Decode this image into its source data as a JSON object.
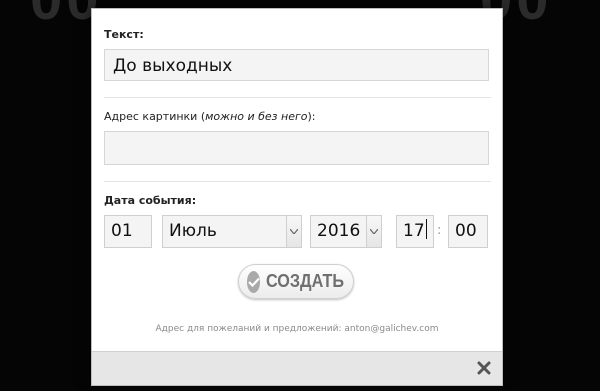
{
  "form": {
    "text_label": "Текст:",
    "text_value": "До выходных",
    "image_label_prefix": "Адрес картинки (",
    "image_label_italic": "можно и без него",
    "image_label_suffix": "):",
    "image_value": "",
    "date_label": "Дата события:",
    "day": "01",
    "month": "Июль",
    "year": "2016",
    "hour": "17",
    "minute": "00",
    "time_separator": ":",
    "create_label": "СОЗДАТЬ",
    "footer": "Адрес для пожеланий и предложений: anton@galichev.com"
  },
  "icons": {
    "create": "check-icon",
    "close": "close-icon",
    "dropdown": "chevron-down-icon"
  },
  "colors": {
    "backdrop": "#050505",
    "button_text": "#6f6f6f",
    "footer_bar": "#e6e6e6"
  }
}
